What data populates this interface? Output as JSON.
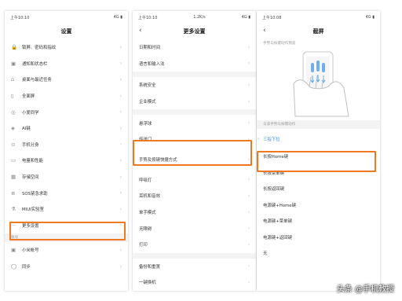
{
  "screen1": {
    "status_time": "上午10:10",
    "status_right": "4G ▮",
    "title": "设置",
    "rows": [
      {
        "icon": "lock-icon",
        "glyph": "🔒",
        "label": "锁屏、密码和指纹"
      },
      {
        "icon": "notification-icon",
        "glyph": "▣",
        "label": "通知和状态栏"
      },
      {
        "icon": "home-icon",
        "glyph": "⌂",
        "label": "桌面与最近任务"
      },
      {
        "icon": "fullscreen-icon",
        "glyph": "▯",
        "label": "全面屏"
      },
      {
        "icon": "assistant-icon",
        "glyph": "◎",
        "label": "小爱同学"
      },
      {
        "icon": "ai-key-icon",
        "glyph": "◈",
        "label": "AI键"
      },
      {
        "icon": "second-space-icon",
        "glyph": "⊙",
        "label": "手机分身"
      },
      {
        "icon": "battery-icon",
        "glyph": "▭",
        "label": "电量和性能"
      },
      {
        "icon": "storage-icon",
        "glyph": "▦",
        "label": "存储空间"
      },
      {
        "icon": "sos-icon",
        "glyph": "⊕",
        "label": "SOS紧急求助"
      },
      {
        "icon": "lab-icon",
        "glyph": "⚗",
        "label": "MIUI实验室"
      },
      {
        "icon": "more-icon",
        "glyph": "···",
        "label": "更多设置"
      }
    ],
    "section_label": "账号",
    "account_rows": [
      {
        "icon": "mi-account-icon",
        "glyph": "▣",
        "label": "小米帐号"
      },
      {
        "icon": "sync-icon",
        "glyph": "◯",
        "label": "同步"
      }
    ]
  },
  "screen2": {
    "status_time": "上午10:10",
    "status_speed": "1.2K/s",
    "status_right": "4G ▮",
    "title": "更多设置",
    "groups": [
      [
        "日期和时间",
        "语言和输入法"
      ],
      [
        "系统安全",
        "企业模式"
      ],
      [
        "悬浮球",
        "传送门",
        "手势及按键快捷方式",
        "呼吸灯",
        "耳机和音效",
        "单手模式",
        "无障碍",
        "打印"
      ],
      [
        "备份和重置",
        "一键换机"
      ]
    ]
  },
  "screen3": {
    "status_time": "上午10:08",
    "status_right": "4G ▮",
    "title": "截屏",
    "section1": "手势与按键动作预览",
    "section2": "与该手势与按键动作",
    "options": [
      "三指下拉",
      "长按Home键",
      "长按菜单键",
      "长按返回键",
      "电源键+Home键",
      "电源键+菜单键",
      "电源键+返回键",
      "无"
    ],
    "selected": "三指下拉"
  },
  "watermark": "头条 @手机教授",
  "accent_color": "#f07820",
  "selected_color": "#3a8ee6"
}
